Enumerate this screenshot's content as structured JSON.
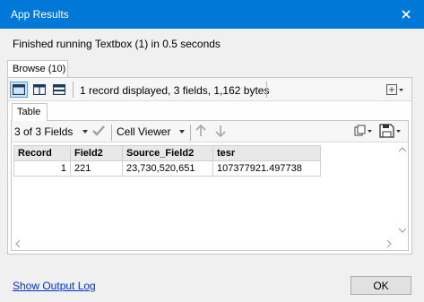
{
  "window": {
    "title": "App Results",
    "close_icon": "close-icon"
  },
  "status_message": "Finished running Textbox (1) in 0.5 seconds",
  "tabs": {
    "browse": "Browse (10)",
    "table": "Table"
  },
  "toolbar": {
    "records_info": "1 record displayed, 3 fields, 1,162 bytes"
  },
  "table_toolbar": {
    "fields_select": "3 of 3 Fields",
    "viewer_select": "Cell Viewer"
  },
  "grid": {
    "headers": [
      "Record",
      "Field2",
      "Source_Field2",
      "tesr"
    ],
    "rows": [
      [
        "1",
        "221",
        "23,730,520,651",
        "107377921.497738"
      ]
    ]
  },
  "footer": {
    "show_output_log": "Show Output Log",
    "ok_label": "OK"
  },
  "colors": {
    "titlebar": "#0078d7",
    "link": "#0033cc"
  }
}
